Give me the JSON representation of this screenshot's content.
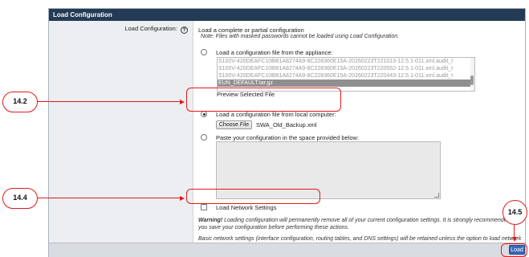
{
  "header": {
    "title": "Load Configuration"
  },
  "field": {
    "label": "Load Configuration:",
    "help_glyph": "?"
  },
  "intro": {
    "text": "Load a complete or partial configuration",
    "note": "Note: Files with masked passwords cannot be loaded using Load Configuration."
  },
  "option_appliance": {
    "label": "Load a configuration file from the appliance:",
    "files": [
      "S100V-420DEAFC10BB1A8274A9-8C228360E15A-20260223T221013-12.5.1-011.xml.audit_t",
      "S100V-420DEAFC10BB1A8274A9-8C228360E15A-20260223T220552-12.5.1-011.xml.audit_t",
      "S100V-420DEAFC10BB1A8274A9-8C228360E15A-20260223T220443-12.5.1-011.xml.audit_t",
      "EUN_DEFAULT.tar.gz"
    ],
    "selected_index": 3,
    "preview_link": "Preview Selected File"
  },
  "option_local": {
    "label": "Load a configuration file from local computer:",
    "choose_button": "Choose File",
    "file_name": "SWA_Old_Backup.xml",
    "selected": true
  },
  "option_paste": {
    "label": "Paste your configuration in the space provided below:"
  },
  "network": {
    "label": "Load Network Settings",
    "checked": false
  },
  "warning": {
    "bold": "Warning!",
    "text": " Loading configuration will permanently remove all of your current configuration settings. It is strongly recommended that you save your configuration before performing these actions."
  },
  "basic_note": "Basic network settings (interface configuration, routing tables, and DNS settings) will be retained unless the option to load network settings is selected.",
  "load_button": "Load",
  "callouts": {
    "c142": "14.2",
    "c144": "14.4",
    "c145": "14.5"
  },
  "colors": {
    "header_bg": "#243b55",
    "accent_red": "#e11a1a",
    "button_blue": "#3a68b8"
  }
}
